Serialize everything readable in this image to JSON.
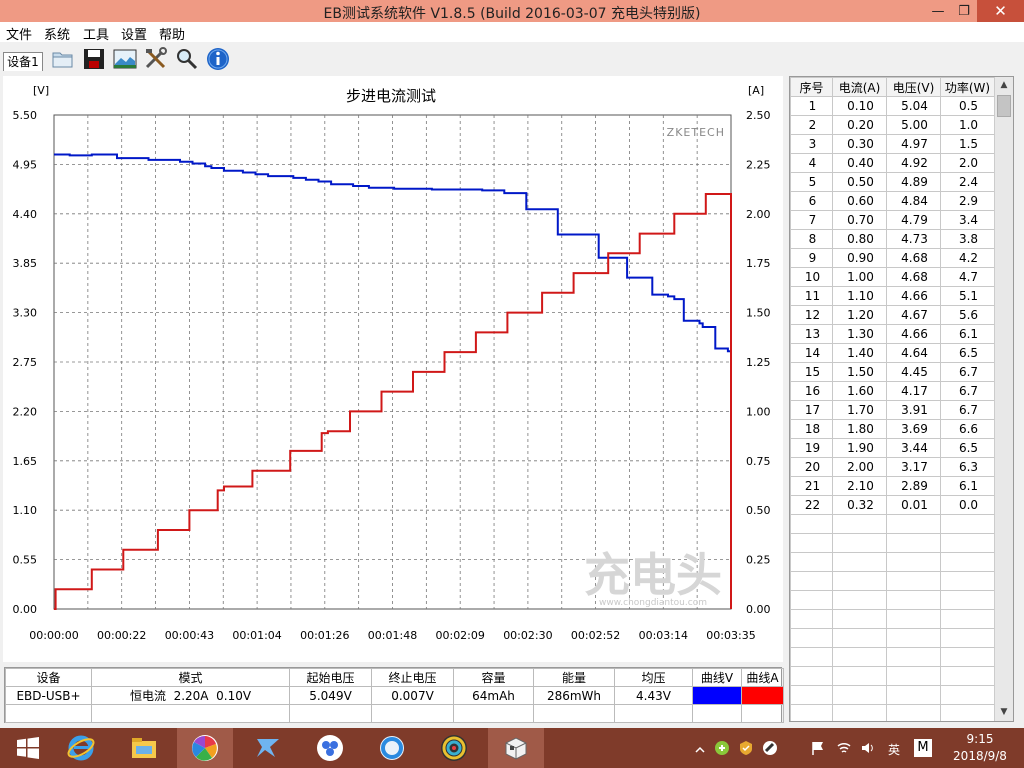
{
  "window": {
    "title": "EB测试系统软件 V1.8.5 (Build 2016-03-07 充电头特别版)",
    "min_glyph": "—",
    "max_glyph": "❐",
    "close_glyph": "✕"
  },
  "menu": [
    "文件",
    "系统",
    "工具",
    "设置",
    "帮助"
  ],
  "toolbar": {
    "device_tab": "设备1",
    "icons": [
      "folder-icon",
      "save-icon",
      "chart-image-icon",
      "tools-icon",
      "magnifier-icon",
      "info-icon"
    ]
  },
  "chart_data": {
    "type": "line",
    "title": "步进电流测试",
    "left_unit": "[V]",
    "right_unit": "[A]",
    "watermark": "ZKETECH",
    "brand_watermark": "充电头",
    "brand_url": "www.chongdiantou.com",
    "y_left": {
      "min": 0,
      "max": 5.5,
      "ticks": [
        "0.00",
        "0.55",
        "1.10",
        "1.65",
        "2.20",
        "2.75",
        "3.30",
        "3.85",
        "4.40",
        "4.95",
        "5.50"
      ]
    },
    "y_right": {
      "min": 0,
      "max": 2.5,
      "ticks": [
        "0.00",
        "0.25",
        "0.50",
        "0.75",
        "1.00",
        "1.25",
        "1.50",
        "1.75",
        "2.00",
        "2.25",
        "2.50"
      ]
    },
    "x": {
      "min_s": 0,
      "max_s": 215,
      "ticks": [
        "00:00:00",
        "00:00:22",
        "00:00:43",
        "00:01:04",
        "00:01:26",
        "00:01:48",
        "00:02:09",
        "00:02:30",
        "00:02:52",
        "00:03:14",
        "00:03:35"
      ]
    },
    "grid": true,
    "series": [
      {
        "axis": "left",
        "color": "#0018c8",
        "points": [
          [
            0,
            5.06
          ],
          [
            5,
            5.05
          ],
          [
            12,
            5.06
          ],
          [
            20,
            5.02
          ],
          [
            30,
            5.0
          ],
          [
            40,
            4.98
          ],
          [
            44,
            4.96
          ],
          [
            48,
            4.93
          ],
          [
            50,
            4.91
          ],
          [
            54,
            4.88
          ],
          [
            60,
            4.86
          ],
          [
            64,
            4.84
          ],
          [
            68,
            4.82
          ],
          [
            76,
            4.8
          ],
          [
            80,
            4.78
          ],
          [
            84,
            4.76
          ],
          [
            88,
            4.73
          ],
          [
            95,
            4.71
          ],
          [
            100,
            4.69
          ],
          [
            108,
            4.68
          ],
          [
            120,
            4.67
          ],
          [
            130,
            4.67
          ],
          [
            136,
            4.66
          ],
          [
            143,
            4.63
          ],
          [
            150,
            4.45
          ],
          [
            156,
            4.45
          ],
          [
            160,
            4.17
          ],
          [
            168,
            4.17
          ],
          [
            173,
            3.91
          ],
          [
            178,
            3.91
          ],
          [
            182,
            3.69
          ],
          [
            188,
            3.69
          ],
          [
            190,
            3.5
          ],
          [
            195,
            3.48
          ],
          [
            197,
            3.45
          ],
          [
            200,
            3.21
          ],
          [
            205,
            3.18
          ],
          [
            206,
            3.14
          ],
          [
            210,
            2.9
          ],
          [
            214,
            2.87
          ],
          [
            215,
            2.86
          ]
        ]
      },
      {
        "axis": "right",
        "color": "#d01818",
        "points": [
          [
            0,
            0.0
          ],
          [
            0.5,
            0.1
          ],
          [
            12,
            0.2
          ],
          [
            22,
            0.3
          ],
          [
            33,
            0.4
          ],
          [
            43,
            0.5
          ],
          [
            52,
            0.6
          ],
          [
            54,
            0.62
          ],
          [
            63,
            0.7
          ],
          [
            75,
            0.8
          ],
          [
            85,
            0.89
          ],
          [
            87,
            0.9
          ],
          [
            94,
            1.0
          ],
          [
            104,
            1.1
          ],
          [
            114,
            1.2
          ],
          [
            124,
            1.3
          ],
          [
            134,
            1.4
          ],
          [
            144,
            1.5
          ],
          [
            155,
            1.6
          ],
          [
            165,
            1.7
          ],
          [
            176,
            1.8
          ],
          [
            186,
            1.9
          ],
          [
            197,
            2.0
          ],
          [
            207,
            2.1
          ],
          [
            215,
            2.1
          ],
          [
            215,
            0.32
          ],
          [
            215,
            0.0
          ]
        ]
      }
    ]
  },
  "summary": {
    "headers": [
      "设备",
      "模式",
      "起始电压",
      "终止电压",
      "容量",
      "能量",
      "均压",
      "曲线V",
      "曲线A"
    ],
    "row": [
      "EBD-USB+",
      "恒电流  2.20A  0.10V",
      "5.049V",
      "0.007V",
      "64mAh",
      "286mWh",
      "4.43V"
    ],
    "curve_v_color": "#0000ff",
    "curve_a_color": "#ff0000"
  },
  "table": {
    "headers": [
      "序号",
      "电流(A)",
      "电压(V)",
      "功率(W)"
    ],
    "rows": [
      [
        "1",
        "0.10",
        "5.04",
        "0.5"
      ],
      [
        "2",
        "0.20",
        "5.00",
        "1.0"
      ],
      [
        "3",
        "0.30",
        "4.97",
        "1.5"
      ],
      [
        "4",
        "0.40",
        "4.92",
        "2.0"
      ],
      [
        "5",
        "0.50",
        "4.89",
        "2.4"
      ],
      [
        "6",
        "0.60",
        "4.84",
        "2.9"
      ],
      [
        "7",
        "0.70",
        "4.79",
        "3.4"
      ],
      [
        "8",
        "0.80",
        "4.73",
        "3.8"
      ],
      [
        "9",
        "0.90",
        "4.68",
        "4.2"
      ],
      [
        "10",
        "1.00",
        "4.68",
        "4.7"
      ],
      [
        "11",
        "1.10",
        "4.66",
        "5.1"
      ],
      [
        "12",
        "1.20",
        "4.67",
        "5.6"
      ],
      [
        "13",
        "1.30",
        "4.66",
        "6.1"
      ],
      [
        "14",
        "1.40",
        "4.64",
        "6.5"
      ],
      [
        "15",
        "1.50",
        "4.45",
        "6.7"
      ],
      [
        "16",
        "1.60",
        "4.17",
        "6.7"
      ],
      [
        "17",
        "1.70",
        "3.91",
        "6.7"
      ],
      [
        "18",
        "1.80",
        "3.69",
        "6.6"
      ],
      [
        "19",
        "1.90",
        "3.44",
        "6.5"
      ],
      [
        "20",
        "2.00",
        "3.17",
        "6.3"
      ],
      [
        "21",
        "2.10",
        "2.89",
        "6.1"
      ],
      [
        "22",
        "0.32",
        "0.01",
        "0.0"
      ]
    ],
    "empty_rows": 11
  },
  "taskbar": {
    "apps": [
      "start-icon",
      "ie-icon",
      "file-explorer-icon",
      "pinwheel-icon",
      "feather-icon",
      "cloud-icon",
      "browser-icon",
      "color-wheel-icon",
      "eb-app-icon"
    ],
    "tray_lang": "英",
    "tray_ime": "M",
    "time": "9:15",
    "date": "2018/9/8"
  }
}
